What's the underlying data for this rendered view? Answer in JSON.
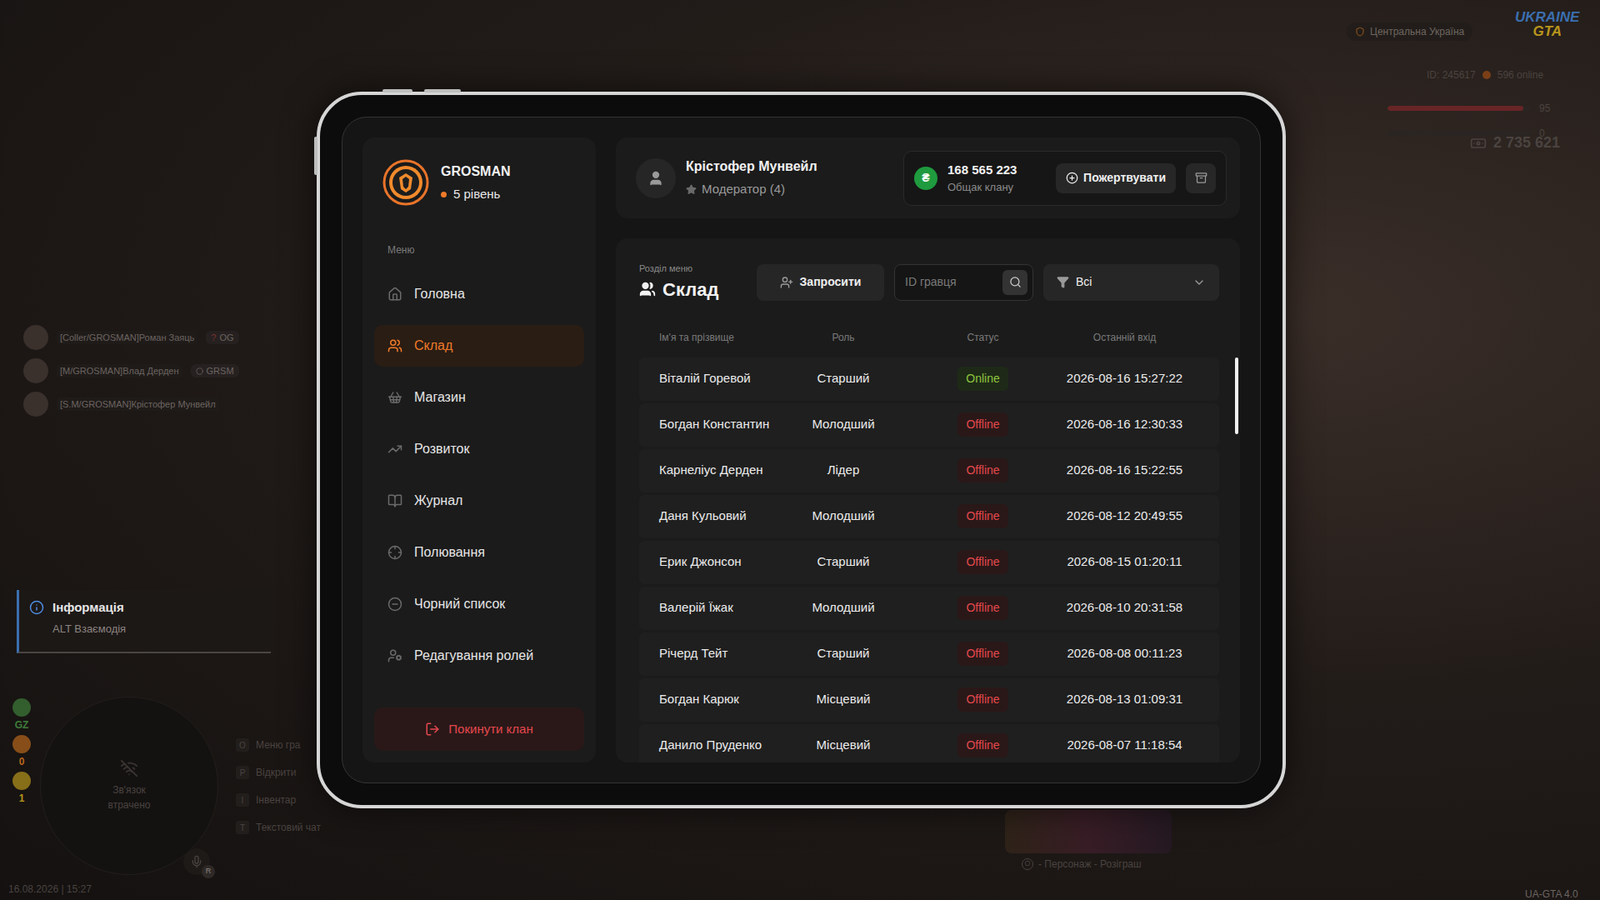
{
  "hud": {
    "region": "Центральна Україна",
    "logo": {
      "top": "UKRAINE",
      "bottom": "GTA"
    },
    "player_id": "ID: 245617",
    "online": "596 online",
    "bars": [
      {
        "name": "health",
        "level": 0.95,
        "reading": "95",
        "color": "#b3262b"
      },
      {
        "name": "armor",
        "level": 0,
        "reading": "0",
        "color": "#8a8a8a"
      }
    ],
    "money": "2 735 621",
    "voice_list": [
      {
        "name": "[Coller/GROSMAN]Роман Заяць",
        "tag_mark": "?",
        "tag": "OG"
      },
      {
        "name": "[M/GROSMAN]Влад Дерден",
        "tag": "GRSM"
      },
      {
        "name": "[S.M/GROSMAN]Крістофер Мунвейл"
      }
    ],
    "notification": {
      "title": "Інформація",
      "subtitle": "ALT Взаємодія"
    },
    "indicators": [
      {
        "value": "GZ",
        "color": "#3f7d3a"
      },
      {
        "value": "0",
        "color": "#b8661c"
      },
      {
        "value": "1",
        "color": "#b8951c"
      }
    ],
    "minimap": {
      "text": "Зв'язок втрачено",
      "mic_key": "R"
    },
    "hotkeys": [
      {
        "key": "O",
        "label": "Меню гра"
      },
      {
        "key": "P",
        "label": "Відкрити"
      },
      {
        "key": "I",
        "label": "Інвентар"
      },
      {
        "key": "T",
        "label": "Текстовий чат"
      }
    ],
    "datetime": "16.08.2026 | 15:27",
    "version": "UA-GTA 4.0",
    "promo": {
      "key": "O",
      "text": "- Персонаж - Розіграш"
    }
  },
  "clan": {
    "name": "GROSMAN",
    "level": "5 рівень"
  },
  "sidebar": {
    "section_label": "Меню",
    "items": [
      {
        "label": "Головна",
        "selected": false
      },
      {
        "label": "Склад",
        "selected": true
      },
      {
        "label": "Магазин",
        "selected": false
      },
      {
        "label": "Розвиток",
        "selected": false
      },
      {
        "label": "Журнал",
        "selected": false
      },
      {
        "label": "Полювання",
        "selected": false
      },
      {
        "label": "Чорний список",
        "selected": false
      },
      {
        "label": "Редагування ролей",
        "selected": false
      }
    ],
    "leave_button": "Покинути клан"
  },
  "profile": {
    "name": "Крістофер Мунвейл",
    "role": "Модератор (4)"
  },
  "treasury": {
    "currency_symbol": "₴",
    "amount": "168 565 223",
    "label": "Общак клану",
    "donate_button": "Пожертвувати"
  },
  "section": {
    "caption": "Розділ меню",
    "title": "Склад",
    "invite_button": "Запросити",
    "search": {
      "placeholder": "ID гравця"
    },
    "filter": {
      "value": "Всі"
    }
  },
  "table": {
    "columns": [
      "Ім'я та прізвище",
      "Роль",
      "Статус",
      "Останній вхід"
    ],
    "rows": [
      {
        "name": "Віталій Горевой",
        "role": "Старший",
        "status": "Online",
        "online": true,
        "last_login": "2026-08-16 15:27:22"
      },
      {
        "name": "Богдан Константин",
        "role": "Молодший",
        "status": "Offline",
        "online": false,
        "last_login": "2026-08-16 12:30:33"
      },
      {
        "name": "Карнеліус Дерден",
        "role": "Лідер",
        "status": "Offline",
        "online": false,
        "last_login": "2026-08-16 15:22:55"
      },
      {
        "name": "Даня Кульовий",
        "role": "Молодший",
        "status": "Offline",
        "online": false,
        "last_login": "2026-08-12 20:49:55"
      },
      {
        "name": "Ерик Джонсон",
        "role": "Старший",
        "status": "Offline",
        "online": false,
        "last_login": "2026-08-15 01:20:11"
      },
      {
        "name": "Валерій Їжак",
        "role": "Молодший",
        "status": "Offline",
        "online": false,
        "last_login": "2026-08-10 20:31:58"
      },
      {
        "name": "Річерд Тейт",
        "role": "Старший",
        "status": "Offline",
        "online": false,
        "last_login": "2026-08-08 00:11:23"
      },
      {
        "name": "Богдан Карюк",
        "role": "Місцевий",
        "status": "Offline",
        "online": false,
        "last_login": "2026-08-13 01:09:31"
      },
      {
        "name": "Данило Пруденко",
        "role": "Місцевий",
        "status": "Offline",
        "online": false,
        "last_login": "2026-08-07 11:18:54"
      }
    ],
    "scrollbar": {
      "level": 0.19
    }
  }
}
